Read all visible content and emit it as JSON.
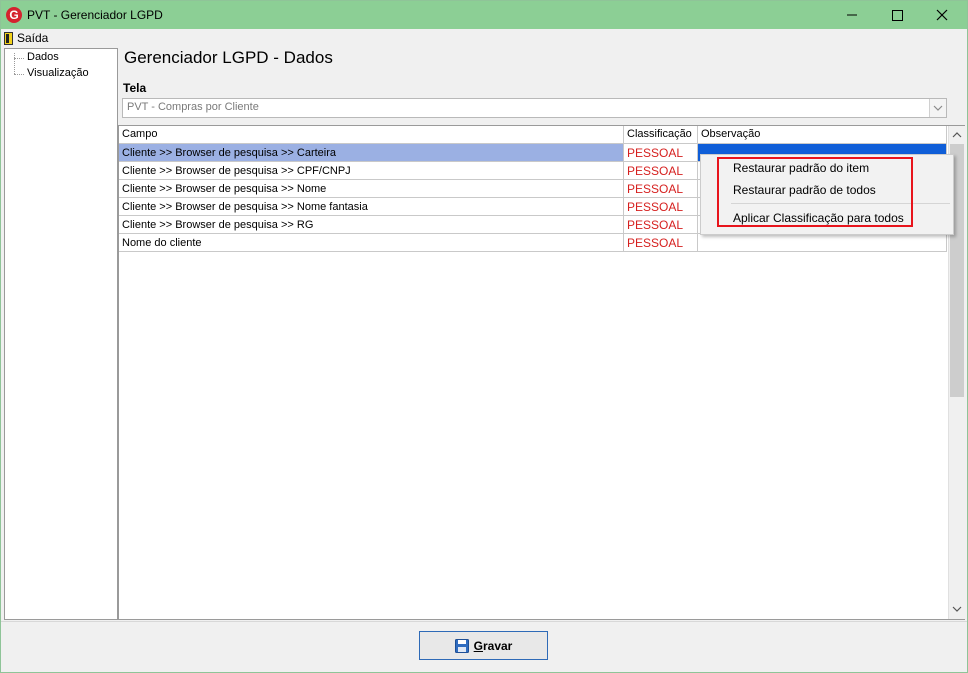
{
  "window": {
    "title": "PVT - Gerenciador LGPD"
  },
  "menubar": {
    "exit_label": "Saída"
  },
  "sidebar": {
    "items": [
      {
        "label": "Dados"
      },
      {
        "label": "Visualização"
      }
    ]
  },
  "main": {
    "title": "Gerenciador LGPD - Dados",
    "tela_label": "Tela",
    "tela_value": "PVT - Compras por Cliente"
  },
  "grid": {
    "columns": [
      "Campo",
      "Classificação",
      "Observação"
    ],
    "rows": [
      {
        "campo": "Cliente >> Browser de pesquisa >> Carteira",
        "classificacao": "PESSOAL",
        "observacao": ""
      },
      {
        "campo": "Cliente >> Browser de pesquisa >> CPF/CNPJ",
        "classificacao": "PESSOAL",
        "observacao": ""
      },
      {
        "campo": "Cliente >> Browser de pesquisa >> Nome",
        "classificacao": "PESSOAL",
        "observacao": ""
      },
      {
        "campo": "Cliente >> Browser de pesquisa >> Nome fantasia",
        "classificacao": "PESSOAL",
        "observacao": ""
      },
      {
        "campo": "Cliente >> Browser de pesquisa >> RG",
        "classificacao": "PESSOAL",
        "observacao": ""
      },
      {
        "campo": "Nome do cliente",
        "classificacao": "PESSOAL",
        "observacao": ""
      }
    ]
  },
  "context_menu": {
    "items": [
      {
        "label": "Restaurar padrão do item"
      },
      {
        "label": "Restaurar padrão de todos"
      },
      {
        "label": "Aplicar Classificação para todos"
      }
    ]
  },
  "footer": {
    "save_label": "Gravar"
  },
  "colors": {
    "titlebar": "#8ccf95",
    "selected_row": "#9bb0e3",
    "selected_cell": "#0f5ed8",
    "classification_text": "#d6201f",
    "highlight_box": "#e8141c"
  },
  "icons": {
    "app": "app-logo-icon",
    "exit": "door-exit-icon",
    "save": "floppy-disk-icon"
  }
}
